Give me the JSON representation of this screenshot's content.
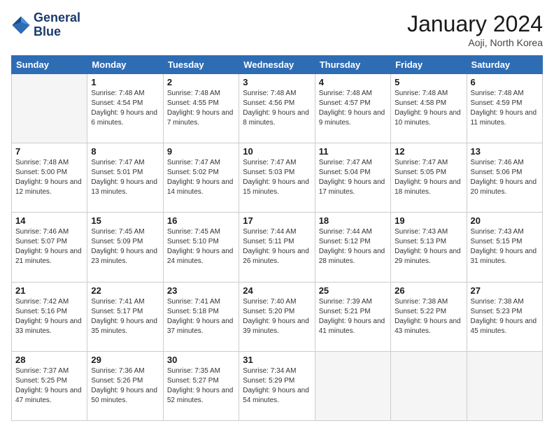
{
  "logo": {
    "line1": "General",
    "line2": "Blue"
  },
  "title": "January 2024",
  "location": "Aoji, North Korea",
  "days_header": [
    "Sunday",
    "Monday",
    "Tuesday",
    "Wednesday",
    "Thursday",
    "Friday",
    "Saturday"
  ],
  "weeks": [
    [
      {
        "day": "",
        "sunrise": "",
        "sunset": "",
        "daylight": ""
      },
      {
        "day": "1",
        "sunrise": "Sunrise: 7:48 AM",
        "sunset": "Sunset: 4:54 PM",
        "daylight": "Daylight: 9 hours and 6 minutes."
      },
      {
        "day": "2",
        "sunrise": "Sunrise: 7:48 AM",
        "sunset": "Sunset: 4:55 PM",
        "daylight": "Daylight: 9 hours and 7 minutes."
      },
      {
        "day": "3",
        "sunrise": "Sunrise: 7:48 AM",
        "sunset": "Sunset: 4:56 PM",
        "daylight": "Daylight: 9 hours and 8 minutes."
      },
      {
        "day": "4",
        "sunrise": "Sunrise: 7:48 AM",
        "sunset": "Sunset: 4:57 PM",
        "daylight": "Daylight: 9 hours and 9 minutes."
      },
      {
        "day": "5",
        "sunrise": "Sunrise: 7:48 AM",
        "sunset": "Sunset: 4:58 PM",
        "daylight": "Daylight: 9 hours and 10 minutes."
      },
      {
        "day": "6",
        "sunrise": "Sunrise: 7:48 AM",
        "sunset": "Sunset: 4:59 PM",
        "daylight": "Daylight: 9 hours and 11 minutes."
      }
    ],
    [
      {
        "day": "7",
        "sunrise": "Sunrise: 7:48 AM",
        "sunset": "Sunset: 5:00 PM",
        "daylight": "Daylight: 9 hours and 12 minutes."
      },
      {
        "day": "8",
        "sunrise": "Sunrise: 7:47 AM",
        "sunset": "Sunset: 5:01 PM",
        "daylight": "Daylight: 9 hours and 13 minutes."
      },
      {
        "day": "9",
        "sunrise": "Sunrise: 7:47 AM",
        "sunset": "Sunset: 5:02 PM",
        "daylight": "Daylight: 9 hours and 14 minutes."
      },
      {
        "day": "10",
        "sunrise": "Sunrise: 7:47 AM",
        "sunset": "Sunset: 5:03 PM",
        "daylight": "Daylight: 9 hours and 15 minutes."
      },
      {
        "day": "11",
        "sunrise": "Sunrise: 7:47 AM",
        "sunset": "Sunset: 5:04 PM",
        "daylight": "Daylight: 9 hours and 17 minutes."
      },
      {
        "day": "12",
        "sunrise": "Sunrise: 7:47 AM",
        "sunset": "Sunset: 5:05 PM",
        "daylight": "Daylight: 9 hours and 18 minutes."
      },
      {
        "day": "13",
        "sunrise": "Sunrise: 7:46 AM",
        "sunset": "Sunset: 5:06 PM",
        "daylight": "Daylight: 9 hours and 20 minutes."
      }
    ],
    [
      {
        "day": "14",
        "sunrise": "Sunrise: 7:46 AM",
        "sunset": "Sunset: 5:07 PM",
        "daylight": "Daylight: 9 hours and 21 minutes."
      },
      {
        "day": "15",
        "sunrise": "Sunrise: 7:45 AM",
        "sunset": "Sunset: 5:09 PM",
        "daylight": "Daylight: 9 hours and 23 minutes."
      },
      {
        "day": "16",
        "sunrise": "Sunrise: 7:45 AM",
        "sunset": "Sunset: 5:10 PM",
        "daylight": "Daylight: 9 hours and 24 minutes."
      },
      {
        "day": "17",
        "sunrise": "Sunrise: 7:44 AM",
        "sunset": "Sunset: 5:11 PM",
        "daylight": "Daylight: 9 hours and 26 minutes."
      },
      {
        "day": "18",
        "sunrise": "Sunrise: 7:44 AM",
        "sunset": "Sunset: 5:12 PM",
        "daylight": "Daylight: 9 hours and 28 minutes."
      },
      {
        "day": "19",
        "sunrise": "Sunrise: 7:43 AM",
        "sunset": "Sunset: 5:13 PM",
        "daylight": "Daylight: 9 hours and 29 minutes."
      },
      {
        "day": "20",
        "sunrise": "Sunrise: 7:43 AM",
        "sunset": "Sunset: 5:15 PM",
        "daylight": "Daylight: 9 hours and 31 minutes."
      }
    ],
    [
      {
        "day": "21",
        "sunrise": "Sunrise: 7:42 AM",
        "sunset": "Sunset: 5:16 PM",
        "daylight": "Daylight: 9 hours and 33 minutes."
      },
      {
        "day": "22",
        "sunrise": "Sunrise: 7:41 AM",
        "sunset": "Sunset: 5:17 PM",
        "daylight": "Daylight: 9 hours and 35 minutes."
      },
      {
        "day": "23",
        "sunrise": "Sunrise: 7:41 AM",
        "sunset": "Sunset: 5:18 PM",
        "daylight": "Daylight: 9 hours and 37 minutes."
      },
      {
        "day": "24",
        "sunrise": "Sunrise: 7:40 AM",
        "sunset": "Sunset: 5:20 PM",
        "daylight": "Daylight: 9 hours and 39 minutes."
      },
      {
        "day": "25",
        "sunrise": "Sunrise: 7:39 AM",
        "sunset": "Sunset: 5:21 PM",
        "daylight": "Daylight: 9 hours and 41 minutes."
      },
      {
        "day": "26",
        "sunrise": "Sunrise: 7:38 AM",
        "sunset": "Sunset: 5:22 PM",
        "daylight": "Daylight: 9 hours and 43 minutes."
      },
      {
        "day": "27",
        "sunrise": "Sunrise: 7:38 AM",
        "sunset": "Sunset: 5:23 PM",
        "daylight": "Daylight: 9 hours and 45 minutes."
      }
    ],
    [
      {
        "day": "28",
        "sunrise": "Sunrise: 7:37 AM",
        "sunset": "Sunset: 5:25 PM",
        "daylight": "Daylight: 9 hours and 47 minutes."
      },
      {
        "day": "29",
        "sunrise": "Sunrise: 7:36 AM",
        "sunset": "Sunset: 5:26 PM",
        "daylight": "Daylight: 9 hours and 50 minutes."
      },
      {
        "day": "30",
        "sunrise": "Sunrise: 7:35 AM",
        "sunset": "Sunset: 5:27 PM",
        "daylight": "Daylight: 9 hours and 52 minutes."
      },
      {
        "day": "31",
        "sunrise": "Sunrise: 7:34 AM",
        "sunset": "Sunset: 5:29 PM",
        "daylight": "Daylight: 9 hours and 54 minutes."
      },
      {
        "day": "",
        "sunrise": "",
        "sunset": "",
        "daylight": ""
      },
      {
        "day": "",
        "sunrise": "",
        "sunset": "",
        "daylight": ""
      },
      {
        "day": "",
        "sunrise": "",
        "sunset": "",
        "daylight": ""
      }
    ]
  ]
}
